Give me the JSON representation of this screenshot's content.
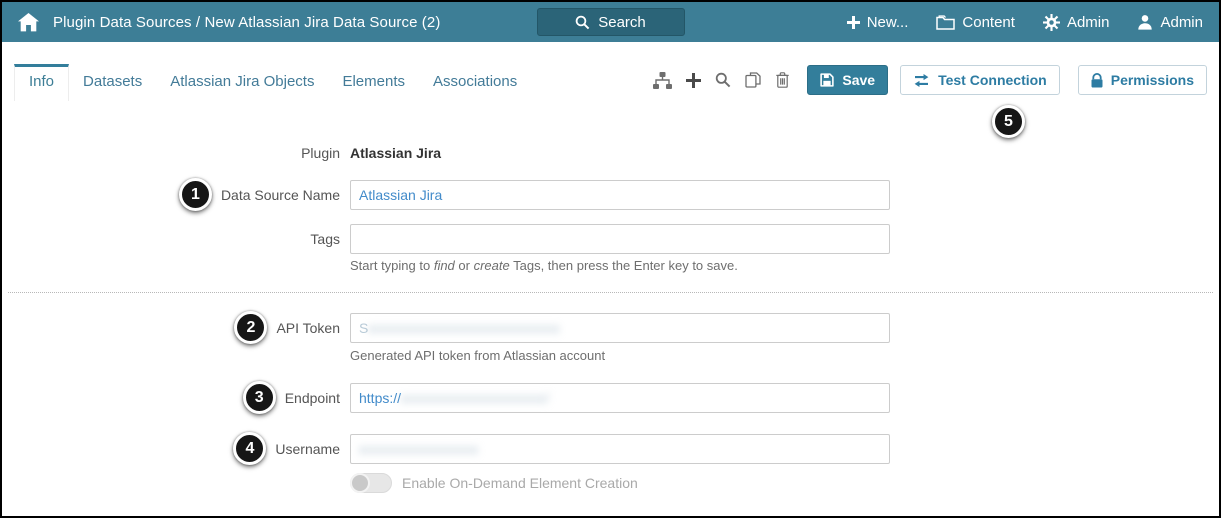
{
  "colors": {
    "header_bg": "#3d7e96",
    "search_button_bg": "#2b6478",
    "accent_teal": "#337e9b",
    "outline_button_text": "#2d7ca3",
    "input_text_blue": "#428bca",
    "callout_bg": "#161616"
  },
  "header": {
    "breadcrumb": "Plugin Data Sources / New Atlassian Jira Data Source (2)",
    "search_label": "Search",
    "new_label": "New...",
    "content_label": "Content",
    "admin_label": "Admin",
    "user_label": "Admin"
  },
  "tabs": [
    {
      "label": "Info",
      "active": true
    },
    {
      "label": "Datasets",
      "active": false
    },
    {
      "label": "Atlassian Jira Objects",
      "active": false
    },
    {
      "label": "Elements",
      "active": false
    },
    {
      "label": "Associations",
      "active": false
    }
  ],
  "toolbar": {
    "save_label": "Save",
    "test_connection_label": "Test Connection",
    "permissions_label": "Permissions"
  },
  "callouts": {
    "one": "1",
    "two": "2",
    "three": "3",
    "four": "4",
    "five": "5"
  },
  "form": {
    "plugin": {
      "label": "Plugin",
      "value": "Atlassian Jira"
    },
    "data_source_name": {
      "label": "Data Source Name",
      "value": "Atlassian Jira"
    },
    "tags": {
      "label": "Tags",
      "value": "",
      "help": {
        "p1": "Start typing to ",
        "i1": "find",
        "p2": " or ",
        "i2": "create",
        "p3": " Tags, then press the Enter key to save."
      }
    },
    "api_token": {
      "label": "API Token",
      "prefix": "S",
      "redacted": "xxxxxxxxxxxxxxxxxxxxxxxx",
      "help": "Generated API token from Atlassian account"
    },
    "endpoint": {
      "label": "Endpoint",
      "prefix": "https://",
      "redacted": "xxxxxxxxxxxxxxxxxx/"
    },
    "username": {
      "label": "Username",
      "redacted": "xxxxxxxxxxxxxxx"
    },
    "on_demand_toggle": {
      "label": "Enable On-Demand Element Creation",
      "enabled": false
    }
  }
}
